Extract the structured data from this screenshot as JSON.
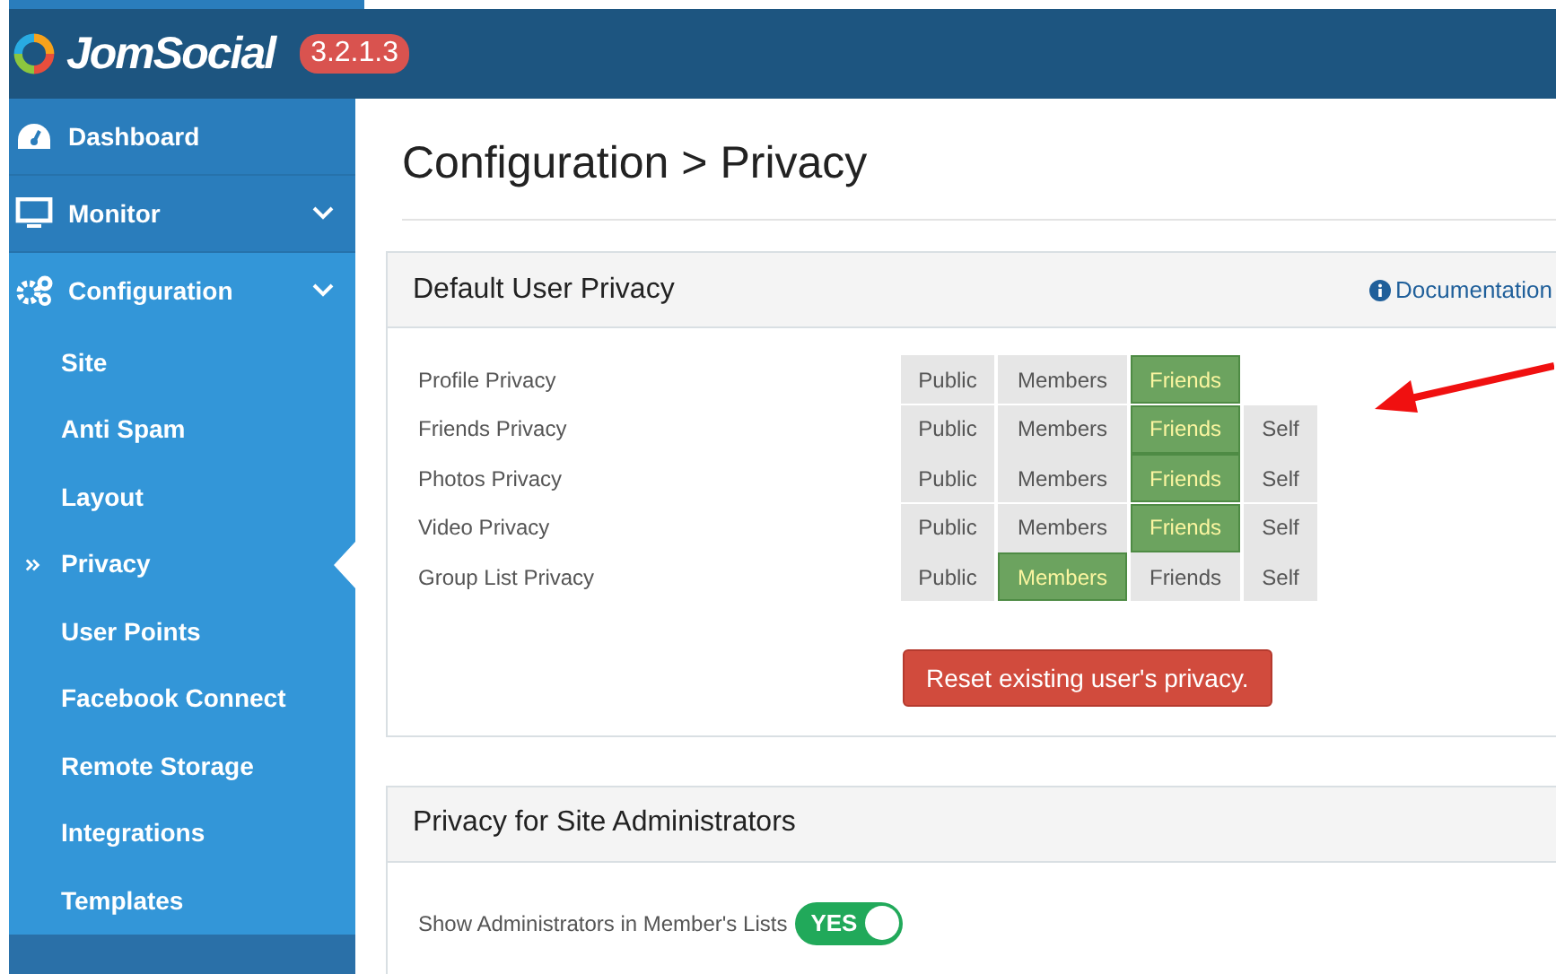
{
  "header": {
    "brand": "JomSocial",
    "version": "3.2.1.3"
  },
  "sidebar": {
    "items": [
      {
        "label": "Dashboard",
        "kind": "link"
      },
      {
        "label": "Monitor",
        "kind": "group"
      },
      {
        "label": "Configuration",
        "kind": "group",
        "expanded": true,
        "children": [
          {
            "label": "Site",
            "selected": false
          },
          {
            "label": "Anti Spam",
            "selected": false
          },
          {
            "label": "Layout",
            "selected": false
          },
          {
            "label": "Privacy",
            "selected": true
          },
          {
            "label": "User Points",
            "selected": false
          },
          {
            "label": "Facebook Connect",
            "selected": false
          },
          {
            "label": "Remote Storage",
            "selected": false
          },
          {
            "label": "Integrations",
            "selected": false
          },
          {
            "label": "Templates",
            "selected": false
          }
        ]
      }
    ]
  },
  "page_title": "Configuration > Privacy",
  "default_privacy": {
    "title": "Default User Privacy",
    "documentation_link": "Documentation",
    "rows": [
      {
        "label": "Profile Privacy",
        "options": [
          {
            "label": "Public",
            "selected": false
          },
          {
            "label": "Members",
            "selected": false
          },
          {
            "label": "Friends",
            "selected": true
          }
        ]
      },
      {
        "label": "Friends Privacy",
        "options": [
          {
            "label": "Public",
            "selected": false
          },
          {
            "label": "Members",
            "selected": false
          },
          {
            "label": "Friends",
            "selected": true
          },
          {
            "label": "Self",
            "selected": false
          }
        ]
      },
      {
        "label": "Photos Privacy",
        "options": [
          {
            "label": "Public",
            "selected": false
          },
          {
            "label": "Members",
            "selected": false
          },
          {
            "label": "Friends",
            "selected": true
          },
          {
            "label": "Self",
            "selected": false
          }
        ]
      },
      {
        "label": "Video Privacy",
        "options": [
          {
            "label": "Public",
            "selected": false
          },
          {
            "label": "Members",
            "selected": false
          },
          {
            "label": "Friends",
            "selected": true
          },
          {
            "label": "Self",
            "selected": false
          }
        ]
      },
      {
        "label": "Group List Privacy",
        "options": [
          {
            "label": "Public",
            "selected": false
          },
          {
            "label": "Members",
            "selected": true
          },
          {
            "label": "Friends",
            "selected": false
          },
          {
            "label": "Self",
            "selected": false
          }
        ]
      }
    ],
    "reset_button": "Reset existing user's privacy."
  },
  "admin_privacy": {
    "title": "Privacy for Site Administrators",
    "settings": [
      {
        "label": "Show Administrators in Member's Lists",
        "on": true,
        "toggle_text": "YES"
      }
    ]
  }
}
